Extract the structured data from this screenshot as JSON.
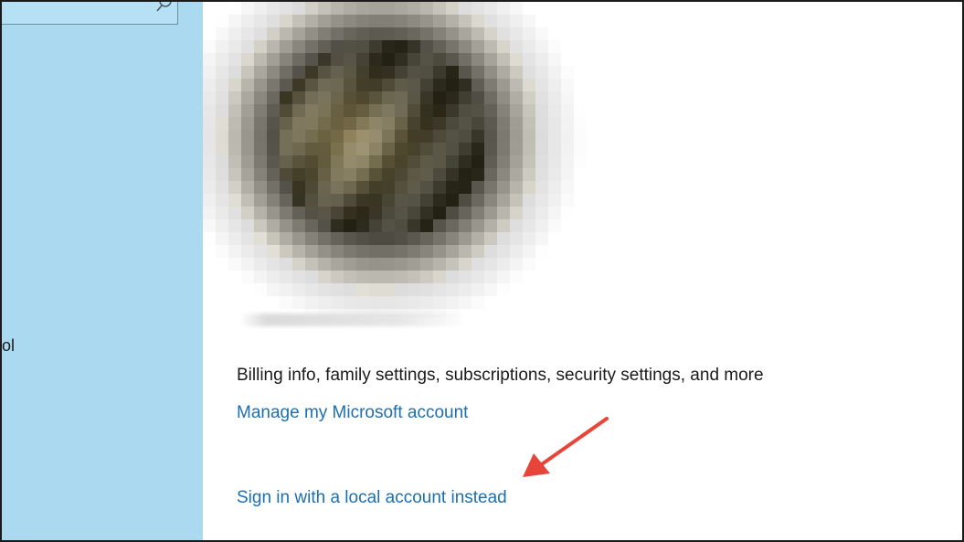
{
  "sidebar": {
    "search_placeholder": "",
    "partial_label": "ol"
  },
  "main": {
    "description": "Billing info, family settings, subscriptions, security settings, and more",
    "manage_link": "Manage my Microsoft account",
    "local_account_link": "Sign in with a local account instead"
  },
  "annotation": {
    "arrow_color": "#e8453a"
  },
  "colors": {
    "sidebar_bg": "#abdaf0",
    "link": "#1c6fb0",
    "text": "#1a1a1a"
  }
}
